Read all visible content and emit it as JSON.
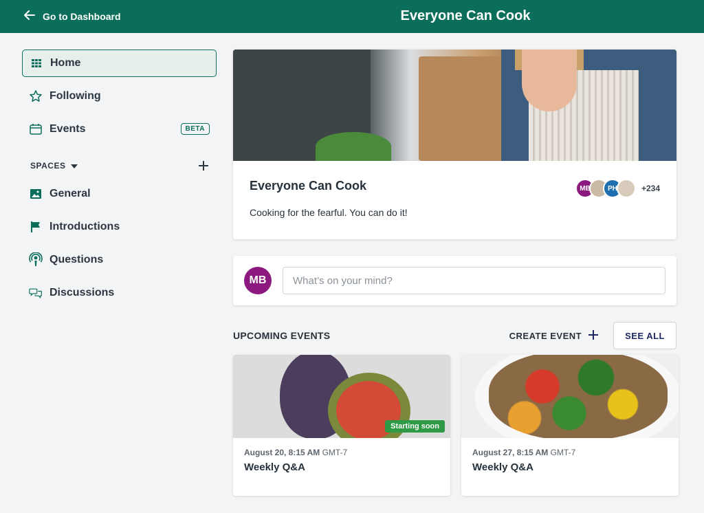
{
  "topbar": {
    "back_label": "Go to Dashboard",
    "title": "Everyone Can Cook"
  },
  "sidebar": {
    "items": [
      {
        "label": "Home",
        "icon": "grid-icon"
      },
      {
        "label": "Following",
        "icon": "star-icon"
      },
      {
        "label": "Events",
        "icon": "calendar-icon",
        "badge": "BETA"
      }
    ],
    "spaces_label": "SPACES",
    "spaces": [
      {
        "label": "General",
        "icon": "image-icon"
      },
      {
        "label": "Introductions",
        "icon": "flag-icon"
      },
      {
        "label": "Questions",
        "icon": "podcast-icon"
      },
      {
        "label": "Discussions",
        "icon": "chat-bubbles-icon"
      }
    ]
  },
  "community": {
    "title": "Everyone Can Cook",
    "description": "Cooking for the fearful. You can do it!",
    "member_initials": [
      "MB",
      "",
      "PH",
      ""
    ],
    "member_count": "+234"
  },
  "composer": {
    "avatar_initials": "MB",
    "placeholder": "What’s on your mind?"
  },
  "events": {
    "section_title": "UPCOMING EVENTS",
    "create_label": "CREATE EVENT",
    "see_all_label": "SEE ALL",
    "items": [
      {
        "date": "August 20, 8:15 AM",
        "tz": "GMT-7",
        "title": "Weekly Q&A",
        "badge": "Starting soon"
      },
      {
        "date": "August 27, 8:15 AM",
        "tz": "GMT-7",
        "title": "Weekly Q&A"
      }
    ]
  },
  "colors": {
    "brand": "#0b6e5b",
    "avatar": "#8c1a7e",
    "starting_soon": "#2f9a46"
  }
}
